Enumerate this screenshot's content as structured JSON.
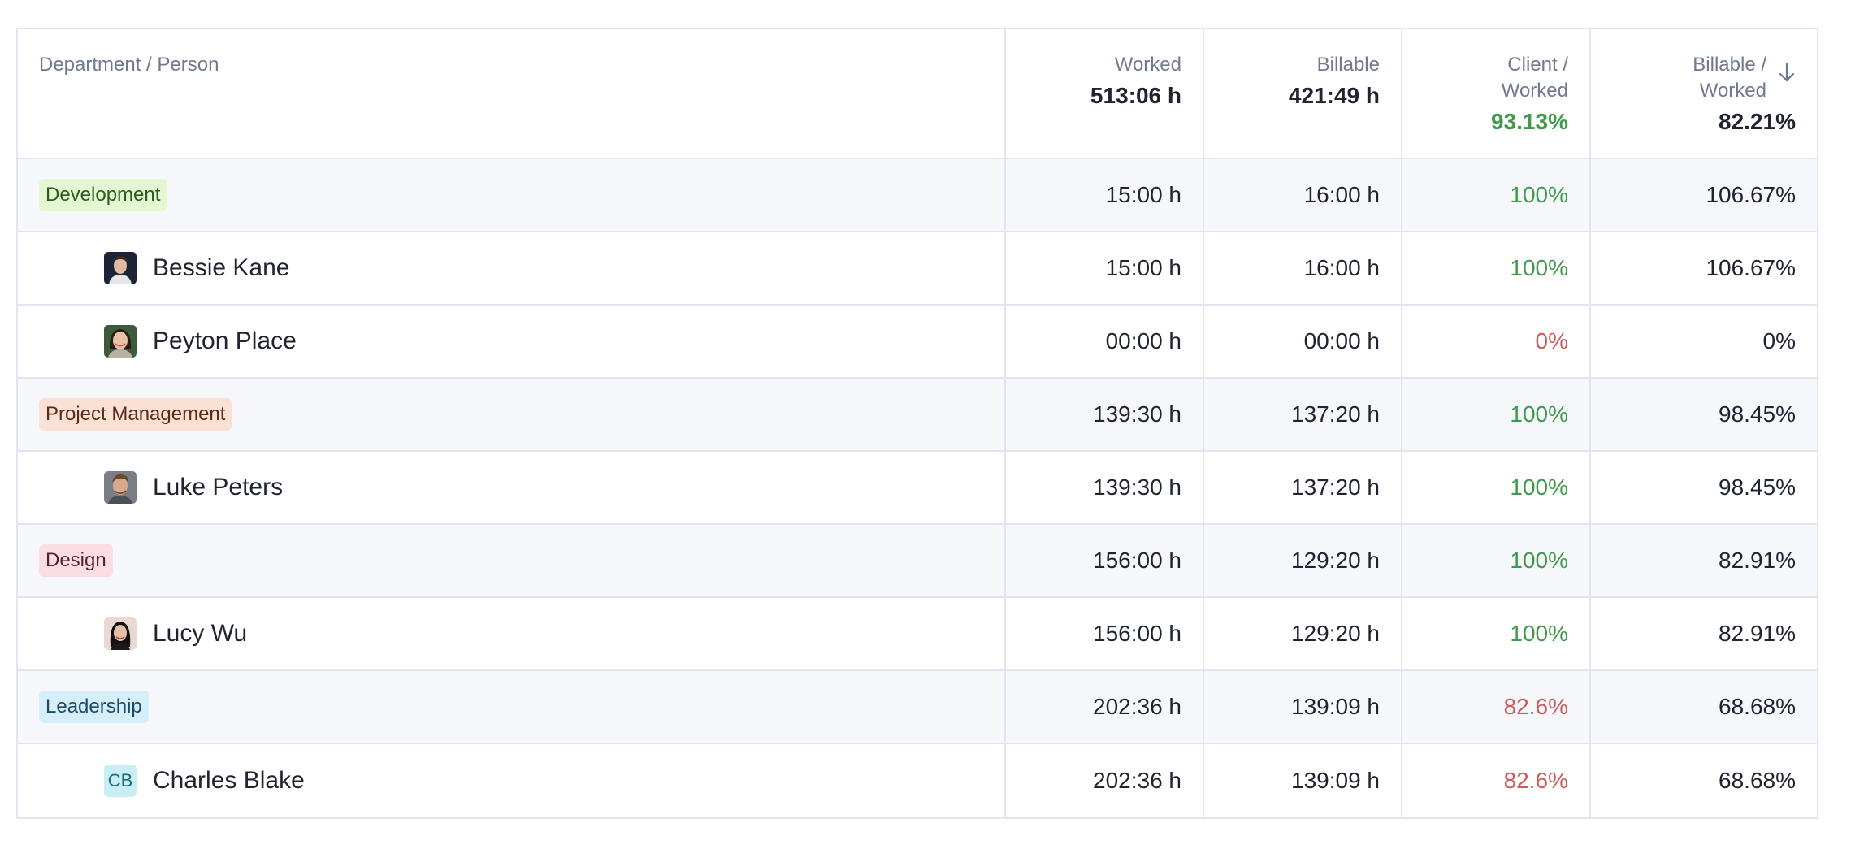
{
  "header": {
    "col_department": "Department / Person",
    "worked": {
      "label": "Worked",
      "total": "513:06 h"
    },
    "billable": {
      "label": "Billable",
      "total": "421:49 h"
    },
    "client_worked": {
      "label_1": "Client /",
      "label_2": "Worked",
      "total": "93.13%",
      "total_color": "#3f9a4b"
    },
    "billable_worked": {
      "label_1": "Billable /",
      "label_2": "Worked",
      "total": "82.21%",
      "sort_icon": "arrow-down-icon"
    }
  },
  "rows": [
    {
      "type": "dept",
      "name": "Development",
      "badge_bg": "#e2f7d2",
      "badge_fg": "#2f5a1e",
      "worked": "15:00 h",
      "billable": "16:00 h",
      "client": "100%",
      "client_status": "good",
      "ratio": "106.67%"
    },
    {
      "type": "person",
      "name": "Bessie Kane",
      "avatar": "photo-avatar",
      "worked": "15:00 h",
      "billable": "16:00 h",
      "client": "100%",
      "client_status": "good",
      "ratio": "106.67%"
    },
    {
      "type": "person",
      "name": "Peyton Place",
      "avatar": "photo-avatar",
      "worked": "00:00 h",
      "billable": "00:00 h",
      "client": "0%",
      "client_status": "bad",
      "ratio": "0%"
    },
    {
      "type": "dept",
      "name": "Project Management",
      "badge_bg": "#fbe0d6",
      "badge_fg": "#5a2a1a",
      "worked": "139:30 h",
      "billable": "137:20 h",
      "client": "100%",
      "client_status": "good",
      "ratio": "98.45%"
    },
    {
      "type": "person",
      "name": "Luke Peters",
      "avatar": "photo-avatar",
      "worked": "139:30 h",
      "billable": "137:20 h",
      "client": "100%",
      "client_status": "good",
      "ratio": "98.45%"
    },
    {
      "type": "dept",
      "name": "Design",
      "badge_bg": "#fbdde4",
      "badge_fg": "#5a1f2c",
      "worked": "156:00 h",
      "billable": "129:20 h",
      "client": "100%",
      "client_status": "good",
      "ratio": "82.91%"
    },
    {
      "type": "person",
      "name": "Lucy Wu",
      "avatar": "photo-avatar",
      "worked": "156:00 h",
      "billable": "129:20 h",
      "client": "100%",
      "client_status": "good",
      "ratio": "82.91%"
    },
    {
      "type": "dept",
      "name": "Leadership",
      "badge_bg": "#d4eefa",
      "badge_fg": "#1c4a63",
      "worked": "202:36 h",
      "billable": "139:09 h",
      "client": "82.6%",
      "client_status": "bad",
      "ratio": "68.68%"
    },
    {
      "type": "person",
      "name": "Charles Blake",
      "avatar": "initials-avatar",
      "initials": "CB",
      "worked": "202:36 h",
      "billable": "139:09 h",
      "client": "82.6%",
      "client_status": "bad",
      "ratio": "68.68%"
    }
  ],
  "colors": {
    "good": "#3f9a4b",
    "bad": "#d05a5a",
    "border": "#e1e5f1",
    "dept_row_bg": "#f6f7fb"
  }
}
